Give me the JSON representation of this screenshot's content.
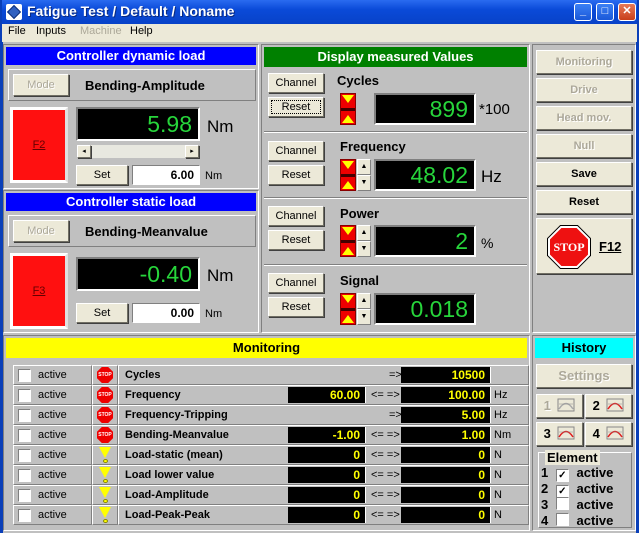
{
  "window": {
    "title": "Fatigue Test / Default / Noname",
    "minimize": "_",
    "maximize": "□",
    "close": "✕"
  },
  "menu": [
    {
      "label": "File",
      "enabled": true
    },
    {
      "label": "Inputs",
      "enabled": true
    },
    {
      "label": "Machine",
      "enabled": false
    },
    {
      "label": "Help",
      "enabled": true
    }
  ],
  "dynamic": {
    "header": "Controller dynamic load",
    "mode_label": "Mode",
    "mode_value": "Bending-Amplitude",
    "fkey": "F2",
    "display_value": "5.98",
    "display_unit": "Nm",
    "set_label": "Set",
    "set_value": "6.00",
    "set_unit": "Nm",
    "colors": {
      "header": "#0000ff",
      "indicator": "#ff1010"
    }
  },
  "static": {
    "header": "Controller static load",
    "mode_label": "Mode",
    "mode_value": "Bending-Meanvalue",
    "fkey": "F3",
    "display_value": "-0.40",
    "display_unit": "Nm",
    "set_label": "Set",
    "set_value": "0.00",
    "set_unit": "Nm"
  },
  "measured": {
    "header": "Display measured Values",
    "header_color": "#008000",
    "channels": [
      {
        "name": "Cycles",
        "value": "899",
        "unit": "*100",
        "channel_label": "Channel",
        "reset_label": "Reset",
        "has_spin": false
      },
      {
        "name": "Frequency",
        "value": "48.02",
        "unit": "Hz",
        "channel_label": "Channel",
        "reset_label": "Reset",
        "has_spin": true
      },
      {
        "name": "Power",
        "value": "2",
        "unit": "%",
        "channel_label": "Channel",
        "reset_label": "Reset",
        "has_spin": true
      },
      {
        "name": "Signal",
        "value": "0.018",
        "unit": "",
        "channel_label": "Channel",
        "reset_label": "Reset",
        "has_spin": true
      }
    ]
  },
  "side_buttons": [
    {
      "label": "Monitoring",
      "enabled": false
    },
    {
      "label": "Drive",
      "enabled": false
    },
    {
      "label": "Head mov.",
      "enabled": false
    },
    {
      "label": "Null",
      "enabled": false
    },
    {
      "label": "Save",
      "enabled": true
    },
    {
      "label": "Reset",
      "enabled": true
    }
  ],
  "stop_button": {
    "icon_text": "STOP",
    "key": "F12"
  },
  "monitoring": {
    "header": "Monitoring",
    "header_color": "#ffff00",
    "rows": [
      {
        "active_label": "active",
        "checked": false,
        "icon": "stop",
        "name": "Cycles",
        "low": "",
        "arrow": "=>",
        "high": "10500",
        "unit": ""
      },
      {
        "active_label": "active",
        "checked": false,
        "icon": "stop",
        "name": "Frequency",
        "low": "60.00",
        "arrow": "<= =>",
        "high": "100.00",
        "unit": "Hz"
      },
      {
        "active_label": "active",
        "checked": false,
        "icon": "stop",
        "name": "Frequency-Tripping",
        "low": "",
        "arrow": "=>",
        "high": "5.00",
        "unit": "Hz"
      },
      {
        "active_label": "active",
        "checked": false,
        "icon": "stop",
        "name": "Bending-Meanvalue",
        "low": "-1.00",
        "arrow": "<= =>",
        "high": "1.00",
        "unit": "Nm"
      },
      {
        "active_label": "active",
        "checked": false,
        "icon": "warning",
        "name": "Load-static (mean)",
        "low": "0",
        "arrow": "<= =>",
        "high": "0",
        "unit": "N"
      },
      {
        "active_label": "active",
        "checked": false,
        "icon": "warning",
        "name": "Load lower value",
        "low": "0",
        "arrow": "<= =>",
        "high": "0",
        "unit": "N"
      },
      {
        "active_label": "active",
        "checked": false,
        "icon": "warning",
        "name": "Load-Amplitude",
        "low": "0",
        "arrow": "<= =>",
        "high": "0",
        "unit": "N"
      },
      {
        "active_label": "active",
        "checked": false,
        "icon": "warning",
        "name": "Load-Peak-Peak",
        "low": "0",
        "arrow": "<= =>",
        "high": "0",
        "unit": "N"
      }
    ]
  },
  "history": {
    "header": "History",
    "header_color": "#00ffff",
    "settings_label": "Settings",
    "chart_buttons": [
      {
        "label": "1",
        "enabled": false
      },
      {
        "label": "2",
        "enabled": true
      },
      {
        "label": "3",
        "enabled": true
      },
      {
        "label": "4",
        "enabled": true
      }
    ],
    "element_group": "Element",
    "elements": [
      {
        "num": "1",
        "label": "active",
        "checked": true
      },
      {
        "num": "2",
        "label": "active",
        "checked": true
      },
      {
        "num": "3",
        "label": "active",
        "checked": false
      },
      {
        "num": "4",
        "label": "active",
        "checked": false
      }
    ]
  }
}
